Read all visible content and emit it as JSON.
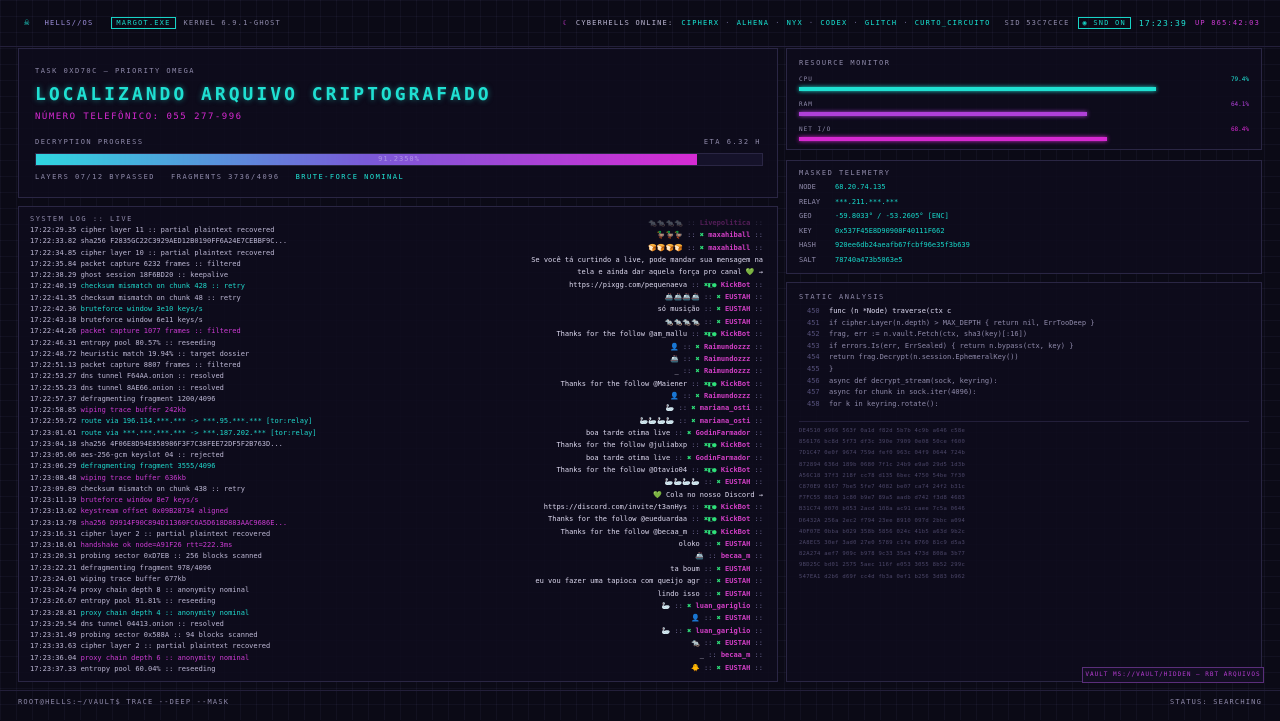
{
  "header": {
    "logo": "HELLS//OS",
    "user_tag": "MARGOT.EXE",
    "kernel": "KERNEL 6.9.1-GHOST",
    "online_label": "CYBERHELLS ONLINE:",
    "online_users": [
      "CIPHERX",
      "ALHENA",
      "NYX",
      "CODEX",
      "GLITCH",
      "CURTO_CIRCUITO"
    ],
    "sid": "SID 53C7CECE",
    "snd": "SND ON",
    "clock": "17:23:39",
    "uptime": "UP 865:42:03"
  },
  "task": {
    "id": "TASK 0XD70C — PRIORITY OMEGA",
    "title": "LOCALIZANDO ARQUIVO CRIPTOGRAFADO",
    "phone": "NÚMERO TELEFÔNICO: 055 277-996",
    "progress_label": "DECRYPTION PROGRESS",
    "eta": "ETA 6.32 H",
    "progress": 0.91,
    "progress_text": "91.2350%",
    "layers": "LAYERS 07/12 BYPASSED",
    "fragments": "FRAGMENTS 3736/4096",
    "mode": "BRUTE-FORCE NOMINAL"
  },
  "resource": {
    "title": "RESOURCE MONITOR",
    "items": [
      {
        "name": "CPU",
        "value": "79.4%",
        "level": 0.794,
        "color": "#1fe0d2"
      },
      {
        "name": "RAM",
        "value": "64.1%",
        "level": 0.641,
        "color": "#b040d8"
      },
      {
        "name": "NET I/O",
        "value": "68.4%",
        "level": 0.684,
        "color": "#d629d1"
      }
    ]
  },
  "telemetry": {
    "title": "MASKED TELEMETRY",
    "rows": [
      {
        "k": "NODE",
        "v": "68.20.74.135"
      },
      {
        "k": "RELAY",
        "v": "***.211.***.***"
      },
      {
        "k": "GEO",
        "v": "-59.8033° / -53.2605° [ENC]"
      },
      {
        "k": "KEY",
        "v": "0x537F45E8D90908F40111F662"
      },
      {
        "k": "HASH",
        "v": "920ee6db24aeafb67fcbf96e35f3b639"
      },
      {
        "k": "SALT",
        "v": "78740a473b5063e5"
      }
    ]
  },
  "static": {
    "title": "STATIC ANALYSIS",
    "code": [
      {
        "n": "450",
        "t": "func (n *Node) traverse(ctx c",
        "c": "#dcd8f0"
      },
      {
        "n": "451",
        "t": "if cipher.Layer(n.depth) > MAX_DEPTH { return nil, ErrTooDeep }",
        "c": "#8d88a8"
      },
      {
        "n": "452",
        "t": "frag, err := n.vault.Fetch(ctx, sha3(key)[:16])",
        "c": "#8d88a8"
      },
      {
        "n": "453",
        "t": "if errors.Is(err, ErrSealed) { return n.bypass(ctx, key) }",
        "c": "#8d88a8"
      },
      {
        "n": "454",
        "t": "return frag.Decrypt(n.session.EphemeralKey())",
        "c": "#8d88a8"
      },
      {
        "n": "455",
        "t": "}",
        "c": "#8d88a8"
      },
      {
        "n": "456",
        "t": "async def decrypt_stream(sock, keyring):",
        "c": "#8d88a8"
      },
      {
        "n": "457",
        "t": "async for chunk in sock.iter(4096):",
        "c": "#8d88a8"
      },
      {
        "n": "458",
        "t": "for k in keyring.rotate():",
        "c": "#8d88a8"
      }
    ],
    "hex": [
      "DE4510 d966 563f 0a1d f82d 5b7b 4c9b a646 c58e",
      "856176 bc8d 5f73 df3c 390e 7909 0e08 50ce f600",
      "7D1C47 0e0f 9674 759d fef0 963c 04f9 0644 724b",
      "872894 636d 189b 0680 7f1c 24b9 e9a0 29d5 1d3b",
      "A56C18 37f3 218f cc78 d135 6bec 4750 54be 7f30",
      "C870E9 0167 7be5 5fe7 4082 be07 ca74 24f2 b31c",
      "F7FC55 88c9 1c80 b9e7 89a5 aadb d742 f3d8 4683",
      "B31C74 0070 b053 2acd 108a ac91 caee 7c5a 0646",
      "D6432A 256a 2ec2 f794 23ee 8910 097d 2bbc a094",
      "40F07E 0bba b029 358b 5856 024c 41b5 a63d 9b2c",
      "2A8EC5 30ef 3ad0 27e0 5789 c1fe 8760 81c9 d5a3",
      "82A274 aef7 909c b978 9c33 35e3 473d 808a 3b77",
      "9BD25C bd01 2575 5aec 116f e053 3055 8b52 299c",
      "547EA1 d2b6 d69f cc4d fb3a 0ef1 b256 3d83 b962"
    ]
  },
  "syslog": {
    "title": "SYSTEM LOG :: LIVE",
    "lines": [
      {
        "t": "17:22:29.35",
        "m": "cipher layer 11 :: partial plaintext recovered",
        "c": "#b9b4d0"
      },
      {
        "t": "17:22:33.82",
        "m": "sha256 F2835GC22C3929AED12B0190FF6A24E7CEBBF9C...",
        "c": "#b9b4d0"
      },
      {
        "t": "17:22:34.85",
        "m": "cipher layer 10 :: partial plaintext recovered",
        "c": "#b9b4d0"
      },
      {
        "t": "17:22:35.84",
        "m": "packet capture 6232 frames :: filtered",
        "c": "#b9b4d0"
      },
      {
        "t": "17:22:38.29",
        "m": "ghost session 18F6BD20 :: keepalive",
        "c": "#b9b4d0"
      },
      {
        "t": "17:22:40.19",
        "m": "checksum mismatch on chunk 428 :: retry",
        "c": "#1fd4c8"
      },
      {
        "t": "17:22:41.35",
        "m": "checksum mismatch on chunk 48 :: retry",
        "c": "#b9b4d0"
      },
      {
        "t": "17:22:42.36",
        "m": "bruteforce window 3e10 keys/s",
        "c": "#1fd4c8"
      },
      {
        "t": "17:22:43.18",
        "m": "bruteforce window 6e11 keys/s",
        "c": "#b9b4d0"
      },
      {
        "t": "17:22:44.26",
        "m": "packet capture 1077 frames :: filtered",
        "c": "#c93ad0"
      },
      {
        "t": "17:22:46.31",
        "m": "entropy pool 80.57% :: reseeding",
        "c": "#b9b4d0"
      },
      {
        "t": "17:22:48.72",
        "m": "heuristic match 19.94% :: target dossier",
        "c": "#b9b4d0"
      },
      {
        "t": "17:22:51.13",
        "m": "packet capture 8807 frames :: filtered",
        "c": "#b9b4d0"
      },
      {
        "t": "17:22:53.27",
        "m": "dns tunnel F64AA.onion :: resolved",
        "c": "#b9b4d0"
      },
      {
        "t": "17:22:55.23",
        "m": "dns tunnel 8AE66.onion :: resolved",
        "c": "#b9b4d0"
      },
      {
        "t": "17:22:57.37",
        "m": "defragmenting fragment 1200/4096",
        "c": "#b9b4d0"
      },
      {
        "t": "17:22:58.85",
        "m": "wiping trace buffer 242kb",
        "c": "#c93ad0"
      },
      {
        "t": "17:22:59.72",
        "m": "route via 196.114.***.*** -> ***.95.***.*** [tor:relay]",
        "c": "#1fd4c8"
      },
      {
        "t": "17:23:01.61",
        "m": "route via ***.***.***.*** -> ***.187.202.*** [tor:relay]",
        "c": "#1fd4c8"
      },
      {
        "t": "17:23:04.18",
        "m": "sha256 4F06E8D94E858986F3F7C38FEE72DF5F2B763D...",
        "c": "#b9b4d0"
      },
      {
        "t": "17:23:05.06",
        "m": "aes-256-gcm keyslot 04 :: rejected",
        "c": "#b9b4d0"
      },
      {
        "t": "17:23:06.29",
        "m": "defragmenting fragment 3555/4096",
        "c": "#1fd4c8"
      },
      {
        "t": "17:23:08.48",
        "m": "wiping trace buffer 636kb",
        "c": "#c93ad0"
      },
      {
        "t": "17:23:09.89",
        "m": "checksum mismatch on chunk 438 :: retry",
        "c": "#b9b4d0"
      },
      {
        "t": "17:23:11.19",
        "m": "bruteforce window 8e7 keys/s",
        "c": "#c93ad0"
      },
      {
        "t": "17:23:13.02",
        "m": "keystream offset 0x09B28734 aligned",
        "c": "#c93ad0"
      },
      {
        "t": "17:23:13.78",
        "m": "sha256 D9914F90C894D11360FC6A5D618D883AAC9686E...",
        "c": "#c93ad0"
      },
      {
        "t": "17:23:16.31",
        "m": "cipher layer 2 :: partial plaintext recovered",
        "c": "#b9b4d0"
      },
      {
        "t": "17:23:18.01",
        "m": "handshake ok node=A91F26 rtt=222.3ms",
        "c": "#c93ad0"
      },
      {
        "t": "17:23:20.31",
        "m": "probing sector 0xD7EB :: 256 blocks scanned",
        "c": "#b9b4d0"
      },
      {
        "t": "17:23:22.21",
        "m": "defragmenting fragment 978/4096",
        "c": "#b9b4d0"
      },
      {
        "t": "17:23:24.01",
        "m": "wiping trace buffer 677kb",
        "c": "#b9b4d0"
      },
      {
        "t": "17:23:24.74",
        "m": "proxy chain depth 8 :: anonymity nominal",
        "c": "#b9b4d0"
      },
      {
        "t": "17:23:26.67",
        "m": "entropy pool 91.81% :: reseeding",
        "c": "#b9b4d0"
      },
      {
        "t": "17:23:28.81",
        "m": "proxy chain depth 4 :: anonymity nominal",
        "c": "#1fd4c8"
      },
      {
        "t": "17:23:29.54",
        "m": "dns tunnel 04413.onion :: resolved",
        "c": "#b9b4d0"
      },
      {
        "t": "17:23:31.49",
        "m": "probing sector 0x588A :: 94 blocks scanned",
        "c": "#b9b4d0"
      },
      {
        "t": "17:23:33.63",
        "m": "cipher layer 2 :: partial plaintext recovered",
        "c": "#b9b4d0"
      },
      {
        "t": "17:23:36.04",
        "m": "proxy chain depth 6 :: anonymity nominal",
        "c": "#c93ad0"
      },
      {
        "t": "17:23:37.33",
        "m": "entropy pool 60.04% :: reseeding",
        "c": "#b9b4d0"
      }
    ]
  },
  "chat": [
    {
      "msg": "🐀🐀🐀🐀",
      "user": "Livepolitica",
      "icon": "",
      "dim": true
    },
    {
      "msg": "🦆🦆🦆",
      "user": "maxahiball",
      "icon": "✖",
      "dim": false
    },
    {
      "msg": "🍞🍞🍞🍞",
      "user": "maxahiball",
      "icon": "✖",
      "dim": false
    },
    {
      "msg": "Se você tá curtindo a live, pode mandar sua mensagem na",
      "user": "",
      "icon": "",
      "dim": false
    },
    {
      "msg": "tela e ainda dar aquela força pro canal 💚 →",
      "user": "",
      "icon": "",
      "dim": false
    },
    {
      "msg": "https://pixgg.com/pequenaeva",
      "user": "KickBot",
      "icon": "✖◧●",
      "dim": false
    },
    {
      "msg": "🚢🚢🚢🚢",
      "user": "EUSTAH",
      "icon": "✖",
      "dim": false
    },
    {
      "msg": "só musição",
      "user": "EUSTAH",
      "icon": "✖",
      "dim": false
    },
    {
      "msg": "🐀🐀🐀🐀",
      "user": "EUSTAH",
      "icon": "✖",
      "dim": false
    },
    {
      "msg": "Thanks for the follow @am_mallu",
      "user": "KickBot",
      "icon": "✖◧●",
      "dim": false
    },
    {
      "msg": "👤",
      "user": "Raimundozzz",
      "icon": "✖",
      "dim": false
    },
    {
      "msg": "🚢",
      "user": "Raimundozzz",
      "icon": "✖",
      "dim": false
    },
    {
      "msg": "_",
      "user": "Raimundozzz",
      "icon": "✖",
      "dim": false
    },
    {
      "msg": "Thanks for the follow @Maiener",
      "user": "KickBot",
      "icon": "✖◧●",
      "dim": false
    },
    {
      "msg": "👤",
      "user": "Raimundozzz",
      "icon": "✖",
      "dim": false
    },
    {
      "msg": "🦢",
      "user": "mariana_osti",
      "icon": "✖",
      "dim": false
    },
    {
      "msg": "🦢🦢🦢🦢",
      "user": "mariana_osti",
      "icon": "✖",
      "dim": false
    },
    {
      "msg": "boa tarde otima live",
      "user": "GodinFarmador",
      "icon": "✖",
      "dim": false
    },
    {
      "msg": "Thanks for the follow @juliabxp",
      "user": "KickBot",
      "icon": "✖◧●",
      "dim": false
    },
    {
      "msg": "boa tarde otima live",
      "user": "GodinFarmador",
      "icon": "✖",
      "dim": false
    },
    {
      "msg": "Thanks for the follow @Otavio04",
      "user": "KickBot",
      "icon": "✖◧●",
      "dim": false
    },
    {
      "msg": "🦢🦢🦢🦢",
      "user": "EUSTAH",
      "icon": "✖",
      "dim": false
    },
    {
      "msg": "💚 Cola no nosso Discord →",
      "user": "",
      "icon": "",
      "dim": false
    },
    {
      "msg": "https://discord.com/invite/t3anHys",
      "user": "KickBot",
      "icon": "✖◧●",
      "dim": false
    },
    {
      "msg": "Thanks for the follow @euedu​ardaa",
      "user": "KickBot",
      "icon": "✖◧●",
      "dim": false
    },
    {
      "msg": "Thanks for the follow @becaa_m",
      "user": "KickBot",
      "icon": "✖◧●",
      "dim": false
    },
    {
      "msg": "oloko",
      "user": "EUSTAH",
      "icon": "✖",
      "dim": false
    },
    {
      "msg": "🚢",
      "user": "becaa_m",
      "icon": "",
      "dim": false
    },
    {
      "msg": "ta boum",
      "user": "EUSTAH",
      "icon": "✖",
      "dim": false
    },
    {
      "msg": "eu vou fazer uma tapioca com queijo agr",
      "user": "EUSTAH",
      "icon": "✖",
      "dim": false
    },
    {
      "msg": "lindo isso",
      "user": "EUSTAH",
      "icon": "✖",
      "dim": false
    },
    {
      "msg": "🦢",
      "user": "luan_gariglio",
      "icon": "✖",
      "dim": false
    },
    {
      "msg": "👤",
      "user": "EUSTAH",
      "icon": "✖",
      "dim": false
    },
    {
      "msg": "🦢",
      "user": "luan_gariglio",
      "icon": "✖",
      "dim": false
    },
    {
      "msg": "🐀",
      "user": "EUSTAH",
      "icon": "✖",
      "dim": false
    },
    {
      "msg": "_",
      "user": "becaa_m",
      "icon": "",
      "dim": false
    },
    {
      "msg": "🐥",
      "user": "EUSTAH",
      "icon": "✖",
      "dim": false
    }
  ],
  "footer": {
    "prompt": "ROOT@HELLS:~/VAULT$ TRACE --DEEP --MASK",
    "status": "STATUS: SEARCHING",
    "vault": "VAULT MS://VAULT/HIDDEN — RBT ARQUIVOS"
  }
}
